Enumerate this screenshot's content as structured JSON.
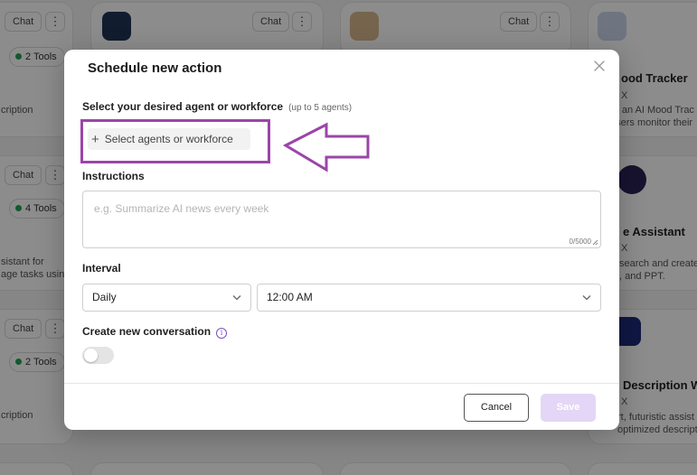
{
  "background": {
    "chat_label": "Chat",
    "more_label": "⋮",
    "cards": [
      {
        "tools": "2 Tools",
        "desc": [
          "cription"
        ]
      },
      {
        "tools": "4 Tools",
        "desc": [
          "sistant for",
          "age tasks usin..."
        ]
      },
      {
        "tools": "2 Tools",
        "desc": [
          "cription"
        ]
      }
    ],
    "right_cards": [
      {
        "title": "ood Tracker",
        "sub": "X",
        "desc": [
          "re an AI Mood Trac",
          "users monitor their"
        ]
      },
      {
        "title": "e Assistant",
        "sub": "X",
        "desc": [
          "search and create c",
          ", and PPT."
        ]
      },
      {
        "title": "Description Writ",
        "sub": "X",
        "desc": [
          "rt, futuristic assist",
          "optimized descripti"
        ]
      }
    ]
  },
  "modal": {
    "title": "Schedule new action",
    "agents_label": "Select your desired agent or workforce",
    "agents_hint": "(up to 5 agents)",
    "agents_button": "Select agents or workforce",
    "instructions_label": "Instructions",
    "instructions_placeholder": "e.g. Summarize AI news every week",
    "instructions_count": "0/5000",
    "interval_label": "Interval",
    "frequency_value": "Daily",
    "time_value": "12:00 AM",
    "new_conversation_label": "Create new conversation",
    "new_conversation_enabled": false,
    "cancel_label": "Cancel",
    "save_label": "Save"
  },
  "colors": {
    "highlight": "#9b45a8",
    "save_disabled": "#e4d6f6",
    "info_icon": "#7a4fc4"
  }
}
